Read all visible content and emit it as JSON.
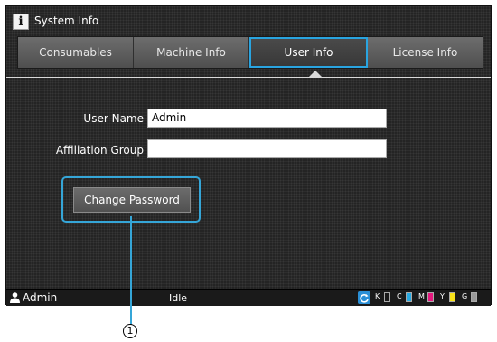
{
  "window": {
    "title": "System Info",
    "icon": "info-icon"
  },
  "tabs": [
    {
      "label": "Consumables",
      "active": false
    },
    {
      "label": "Machine Info",
      "active": false
    },
    {
      "label": "User Info",
      "active": true
    },
    {
      "label": "License Info",
      "active": false
    }
  ],
  "form": {
    "user_name_label": "User Name",
    "user_name_value": "Admin",
    "affiliation_label": "Affiliation Group",
    "affiliation_value": "",
    "change_password_label": "Change Password"
  },
  "status_bar": {
    "user": "Admin",
    "status": "Idle",
    "inks": [
      {
        "label": "K",
        "color": "#1a1a1a"
      },
      {
        "label": "C",
        "color": "#27a9e1"
      },
      {
        "label": "M",
        "color": "#e5197e"
      },
      {
        "label": "Y",
        "color": "#f7e11b"
      },
      {
        "label": "G",
        "color": "#9a9a9a"
      }
    ]
  },
  "callout": {
    "number": "1"
  },
  "colors": {
    "accent": "#29a4e0",
    "background": "#242424"
  }
}
